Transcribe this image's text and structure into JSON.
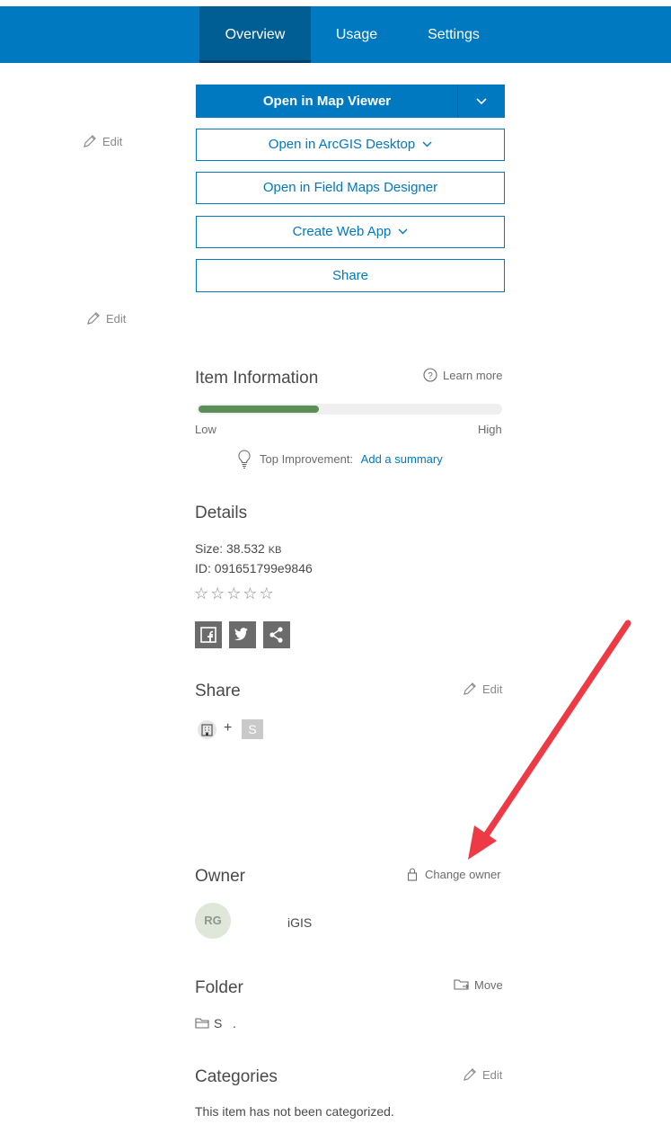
{
  "nav": {
    "tabs": [
      {
        "label": "Overview"
      },
      {
        "label": "Usage"
      },
      {
        "label": "Settings"
      }
    ]
  },
  "actions": {
    "open_map_viewer": "Open in Map Viewer",
    "open_arcgis_desktop": "Open in ArcGIS Desktop",
    "open_field_maps": "Open in Field Maps Designer",
    "create_web_app": "Create Web App",
    "share": "Share"
  },
  "edit_label": "Edit",
  "item_info": {
    "title": "Item Information",
    "learn_more": "Learn more",
    "low": "Low",
    "high": "High",
    "progress": 0.4,
    "top_improvement_label": "Top Improvement:",
    "top_improvement_link": "Add a summary"
  },
  "details": {
    "title": "Details",
    "size_label": "Size: 38.532",
    "size_unit": "KB",
    "id_line": "ID: 091651799e9846",
    "stars_rating": 0,
    "stars": [
      "☆",
      "☆",
      "☆",
      "☆",
      "☆"
    ]
  },
  "share_section": {
    "title": "Share",
    "edit_label": "Edit",
    "plus": "+",
    "group_letter": "S"
  },
  "owner": {
    "title": "Owner",
    "change_owner": "Change owner",
    "initials": "RG",
    "name": "iGIS"
  },
  "folder": {
    "title": "Folder",
    "move": "Move",
    "name": "S   ."
  },
  "categories": {
    "title": "Categories",
    "edit_label": "Edit",
    "empty_text": "This item has not been categorized."
  },
  "colors": {
    "brand_blue": "#0079c1",
    "progress_green": "#5a8f5a",
    "annotation_red": "#ee3a44"
  },
  "icons": {
    "pencil": "pencil-icon",
    "help": "question-circle-icon",
    "lightbulb": "lightbulb-icon",
    "facebook": "facebook-icon",
    "twitter": "twitter-icon",
    "share": "share-icon",
    "organization": "building-icon",
    "lock": "lock-icon",
    "folder": "folder-icon",
    "move": "folder-move-icon"
  }
}
